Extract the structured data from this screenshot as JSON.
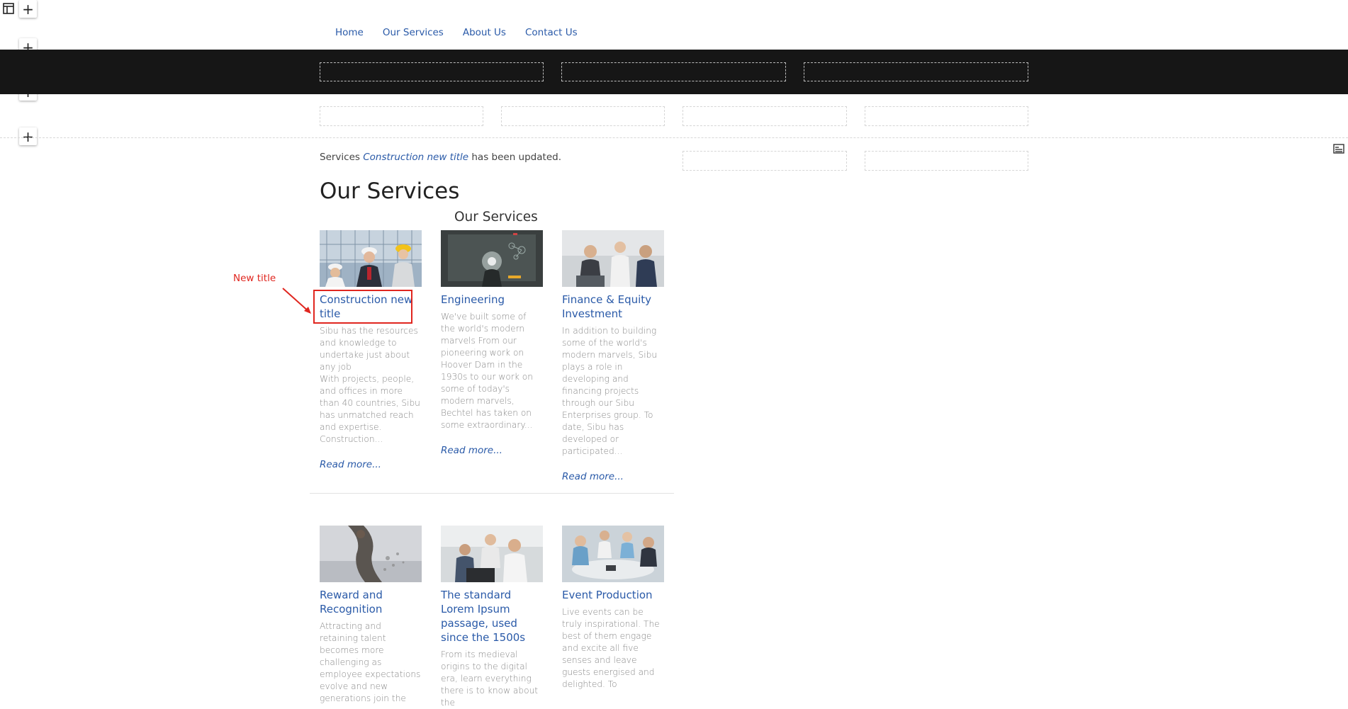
{
  "nav": [
    "Home",
    "Our Services",
    "About Us",
    "Contact Us"
  ],
  "notice": {
    "prefix": "Services",
    "item": "Construction new title",
    "suffix": "has been updated."
  },
  "page_title": "Our Services",
  "section_title": "Our Services",
  "annotation": "New title",
  "read_more": "Read more...",
  "cards_row1": [
    {
      "title": "Construction new title",
      "desc": "Sibu has the resources and knowledge to undertake just about any job\nWith projects, people, and offices in more than 40 countries, Sibu has unmatched reach and expertise. Construction...",
      "image": "construction-workers-photo"
    },
    {
      "title": "Engineering",
      "desc": "We've built some of the world's modern marvels From our pioneering work on Hoover Dam in the 1930s to our work on some of today's modern marvels, Bechtel has taken on some extraordinary...",
      "image": "engineering-tech-photo"
    },
    {
      "title": "Finance & Equity Investment",
      "desc": "In addition to building some of the world's modern marvels, Sibu plays a role in developing and financing projects through our Sibu Enterprises group. To date, Sibu has developed or participated...",
      "image": "finance-meeting-photo"
    }
  ],
  "cards_row2": [
    {
      "title": "Reward and Recognition",
      "desc": "Attracting and retaining talent becomes more challenging as employee expectations evolve and new generations join the",
      "image": "reward-climber-photo"
    },
    {
      "title": "The standard Lorem Ipsum passage, used since the 1500s",
      "desc": "From its medieval origins to the digital era, learn everything there is to know about the",
      "image": "office-team-photo"
    },
    {
      "title": "Event Production",
      "desc": "Live events can be truly inspirational. The best of them engage and excite all five senses and leave guests energised and delighted. To",
      "image": "event-group-photo"
    }
  ],
  "colors": {
    "link": "#2a5aa8",
    "annotation": "#e0261f",
    "band": "#161616"
  }
}
